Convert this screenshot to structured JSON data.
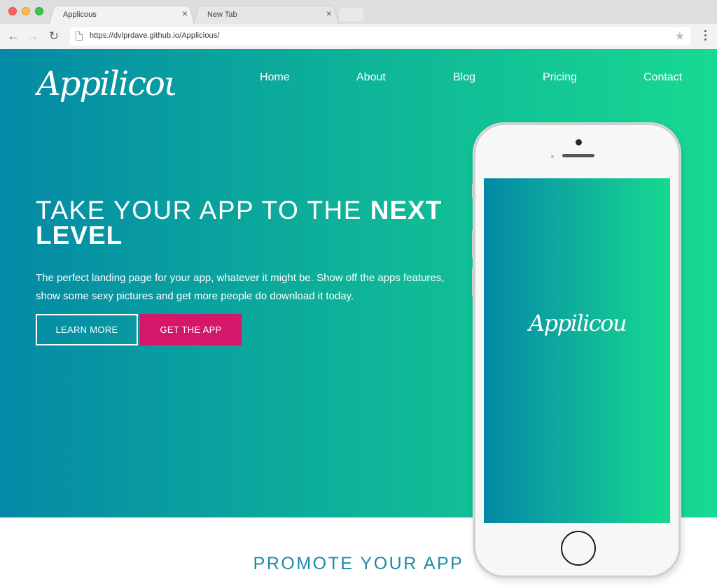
{
  "browser": {
    "tabs": [
      {
        "title": "Applicous"
      },
      {
        "title": "New Tab"
      }
    ],
    "url": "https://dvlprdave.github.io/Applicious/"
  },
  "site": {
    "logo_text": "Appilicous",
    "nav": [
      "Home",
      "About",
      "Blog",
      "Pricing",
      "Contact"
    ],
    "headline_light": "TAKE YOUR APP TO THE ",
    "headline_bold_1": "NEXT",
    "headline_bold_2": "LEVEL",
    "subtext": "The perfect landing page for your app, whatever it might be. Show off the apps features, show some sexy pictures and get more people do download it today.",
    "buttons": {
      "learn_more": "LEARN MORE",
      "get_app": "GET THE APP"
    },
    "section_title": "PROMOTE YOUR APP"
  },
  "colors": {
    "gradient_start": "#0489a6",
    "gradient_end": "#18d992",
    "cta_pink": "#d5176b",
    "section_title": "#1d8aa3"
  },
  "icons": [
    "back-arrow-icon",
    "forward-arrow-icon",
    "reload-icon",
    "page-icon",
    "star-icon",
    "menu-dots-icon",
    "tab-close-icon"
  ]
}
